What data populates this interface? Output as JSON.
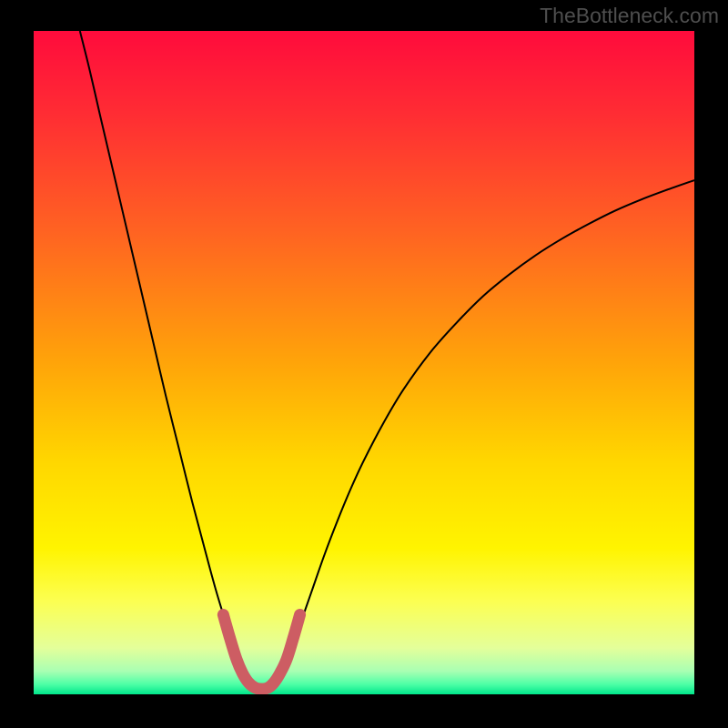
{
  "watermark": "TheBottleneck.com",
  "chart_data": {
    "type": "line",
    "title": "",
    "xlabel": "",
    "ylabel": "",
    "xlim": [
      0,
      100
    ],
    "ylim": [
      0,
      100
    ],
    "background_gradient": {
      "stops": [
        {
          "offset": 0.0,
          "color": "#ff0b3c"
        },
        {
          "offset": 0.12,
          "color": "#ff2b34"
        },
        {
          "offset": 0.3,
          "color": "#ff6222"
        },
        {
          "offset": 0.5,
          "color": "#ffa409"
        },
        {
          "offset": 0.65,
          "color": "#ffd700"
        },
        {
          "offset": 0.78,
          "color": "#fff400"
        },
        {
          "offset": 0.86,
          "color": "#fcff52"
        },
        {
          "offset": 0.93,
          "color": "#e4ff9a"
        },
        {
          "offset": 0.965,
          "color": "#a9ffb3"
        },
        {
          "offset": 0.985,
          "color": "#4dffa6"
        },
        {
          "offset": 1.0,
          "color": "#00e68b"
        }
      ]
    },
    "series": [
      {
        "name": "bottleneck-curve",
        "stroke": "#000000",
        "stroke_width": 2,
        "points": [
          {
            "x": 7.0,
            "y": 100.0
          },
          {
            "x": 8.5,
            "y": 94.0
          },
          {
            "x": 10.0,
            "y": 87.5
          },
          {
            "x": 12.0,
            "y": 79.0
          },
          {
            "x": 14.0,
            "y": 70.5
          },
          {
            "x": 16.0,
            "y": 62.0
          },
          {
            "x": 18.0,
            "y": 53.5
          },
          {
            "x": 20.0,
            "y": 45.0
          },
          {
            "x": 22.0,
            "y": 37.0
          },
          {
            "x": 24.0,
            "y": 29.0
          },
          {
            "x": 26.0,
            "y": 21.5
          },
          {
            "x": 27.5,
            "y": 16.0
          },
          {
            "x": 29.0,
            "y": 11.0
          },
          {
            "x": 30.0,
            "y": 7.5
          },
          {
            "x": 31.0,
            "y": 4.5
          },
          {
            "x": 32.0,
            "y": 2.3
          },
          {
            "x": 33.0,
            "y": 1.0
          },
          {
            "x": 34.0,
            "y": 0.4
          },
          {
            "x": 35.0,
            "y": 0.4
          },
          {
            "x": 36.0,
            "y": 1.0
          },
          {
            "x": 37.0,
            "y": 2.3
          },
          {
            "x": 38.0,
            "y": 4.3
          },
          {
            "x": 39.0,
            "y": 6.8
          },
          {
            "x": 40.0,
            "y": 9.6
          },
          {
            "x": 42.0,
            "y": 15.3
          },
          {
            "x": 44.0,
            "y": 21.0
          },
          {
            "x": 46.0,
            "y": 26.2
          },
          {
            "x": 48.0,
            "y": 31.0
          },
          {
            "x": 50.0,
            "y": 35.3
          },
          {
            "x": 53.0,
            "y": 41.0
          },
          {
            "x": 56.0,
            "y": 46.0
          },
          {
            "x": 60.0,
            "y": 51.5
          },
          {
            "x": 64.0,
            "y": 56.0
          },
          {
            "x": 68.0,
            "y": 60.0
          },
          {
            "x": 72.0,
            "y": 63.3
          },
          {
            "x": 76.0,
            "y": 66.2
          },
          {
            "x": 80.0,
            "y": 68.7
          },
          {
            "x": 84.0,
            "y": 70.9
          },
          {
            "x": 88.0,
            "y": 72.9
          },
          {
            "x": 92.0,
            "y": 74.6
          },
          {
            "x": 96.0,
            "y": 76.1
          },
          {
            "x": 100.0,
            "y": 77.5
          }
        ]
      },
      {
        "name": "optimal-zone-marker",
        "stroke": "#cd5d63",
        "stroke_width": 13,
        "linecap": "round",
        "points": [
          {
            "x": 28.7,
            "y": 12.0
          },
          {
            "x": 29.7,
            "y": 8.5
          },
          {
            "x": 30.7,
            "y": 5.3
          },
          {
            "x": 31.6,
            "y": 3.2
          },
          {
            "x": 32.5,
            "y": 1.8
          },
          {
            "x": 33.5,
            "y": 1.0
          },
          {
            "x": 34.5,
            "y": 0.8
          },
          {
            "x": 35.5,
            "y": 1.0
          },
          {
            "x": 36.4,
            "y": 1.8
          },
          {
            "x": 37.3,
            "y": 3.2
          },
          {
            "x": 38.3,
            "y": 5.3
          },
          {
            "x": 39.3,
            "y": 8.5
          },
          {
            "x": 40.3,
            "y": 12.0
          }
        ]
      }
    ]
  }
}
